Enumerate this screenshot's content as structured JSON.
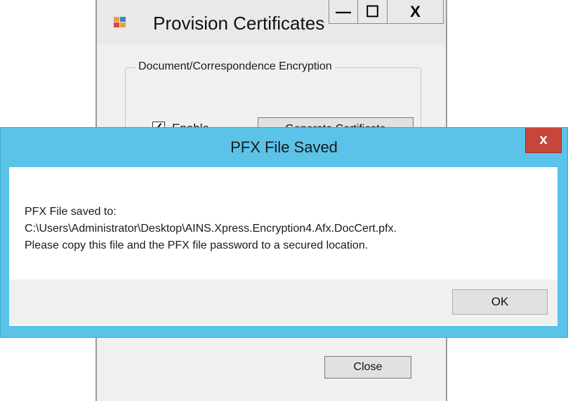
{
  "background_window": {
    "title": "Provision Certificates",
    "groupbox_label": "Document/Correspondence Encryption",
    "checkbox_label": "Enable",
    "checkbox_checked": true,
    "generate_button_label": "Generate Certificate",
    "close_button_label": "Close",
    "minimize_glyph": "—",
    "maximize_glyph": "☐",
    "close_glyph": "X",
    "app_icon": "app-icon"
  },
  "dialog": {
    "title": "PFX File Saved",
    "close_glyph": "x",
    "message_lines": [
      "PFX File saved to:",
      "C:\\Users\\Administrator\\Desktop\\AINS.Xpress.Encryption4.Afx.DocCert.pfx.",
      "Please copy this file and the PFX file password to a secured location."
    ],
    "ok_button_label": "OK",
    "accent_color": "#5bc3e8",
    "close_color": "#c7463b"
  }
}
